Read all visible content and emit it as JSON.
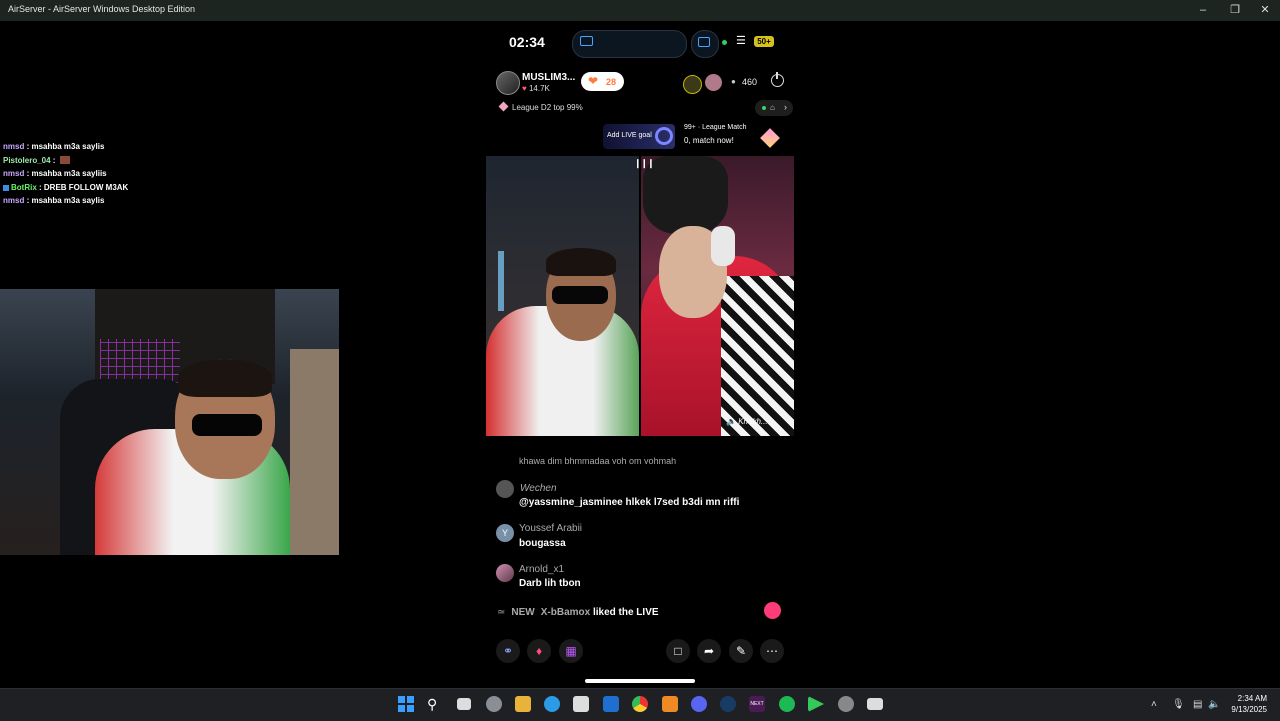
{
  "window": {
    "title": "AirServer - AirServer Windows Desktop Edition"
  },
  "chat": [
    {
      "user": "nmsd",
      "sep": " : ",
      "msg": "msahba m3a saylis",
      "style": "purple"
    },
    {
      "user": "Pistolero_04",
      "sep": " : ",
      "msg": "",
      "style": "green"
    },
    {
      "user": "nmsd",
      "sep": " : ",
      "msg": "msahba m3a sayliis",
      "style": "purple"
    },
    {
      "user": "BotRix",
      "sep": " : ",
      "msg": "DREB FOLLOW M3AK",
      "style": "bot"
    },
    {
      "user": "nmsd",
      "sep": " : ",
      "msg": "msahba m3a saylis",
      "style": "purple"
    }
  ],
  "phone": {
    "time": "02:34",
    "battery": "50+",
    "host": {
      "name": "MUSLIM3...",
      "likes": "14.7K"
    },
    "follow_count": "28",
    "viewer_count": "460",
    "league": "League D2 top 99%",
    "goal": "Add LIVE goal",
    "match_top": "99+ · League Match",
    "match_bottom": "0, match now!",
    "guest_name": "Khokh..."
  },
  "comments": [
    {
      "name": "Wechen",
      "text": "@yassmine_jasminee hlkek l7sed b3di mn riffi"
    },
    {
      "name": "Youssef Arabii",
      "text": "bougassa",
      "initial": "Y"
    },
    {
      "name": "Arnold_x1",
      "text": "Darb lih tbon"
    }
  ],
  "cut_comment": "khawa dim bhmmadaa yoh om yohmah",
  "liked": {
    "new": "NEW",
    "user": "X-bBamox",
    "text": " liked the LIVE"
  },
  "taskbar": {
    "time": "2:34 AM",
    "date": "9/13/2025"
  },
  "icons": {
    "colors": {
      "accent": "#3aa0ff",
      "like": "#ff7a3c",
      "heart": "#ff3c78"
    }
  }
}
